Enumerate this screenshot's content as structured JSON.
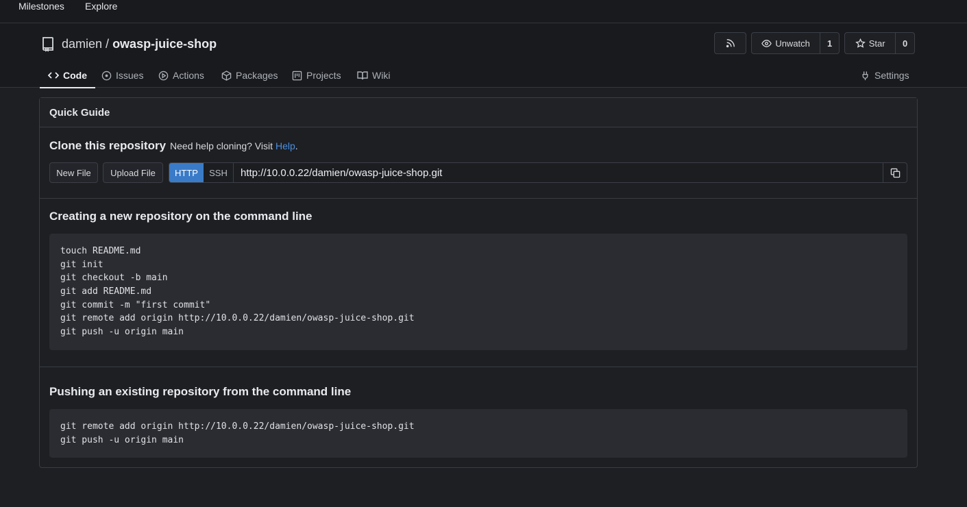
{
  "topnav": {
    "items": [
      "Milestones",
      "Explore"
    ]
  },
  "repo": {
    "owner": "damien",
    "separator": "/",
    "name": "owasp-juice-shop"
  },
  "actions": {
    "unwatch_label": "Unwatch",
    "watch_count": "1",
    "star_label": "Star",
    "star_count": "0"
  },
  "tabs": [
    {
      "label": "Code",
      "icon": "code-icon"
    },
    {
      "label": "Issues",
      "icon": "issue-icon"
    },
    {
      "label": "Actions",
      "icon": "play-icon"
    },
    {
      "label": "Packages",
      "icon": "package-icon"
    },
    {
      "label": "Projects",
      "icon": "project-icon"
    },
    {
      "label": "Wiki",
      "icon": "book-icon"
    }
  ],
  "settings_label": "Settings",
  "quick_guide": {
    "title": "Quick Guide",
    "clone_title": "Clone this repository",
    "clone_help_text": "Need help cloning? Visit",
    "help_link": "Help",
    "help_suffix": ".",
    "new_file_label": "New File",
    "upload_file_label": "Upload File",
    "http_label": "HTTP",
    "ssh_label": "SSH",
    "clone_url": "http://10.0.0.22/damien/owasp-juice-shop.git"
  },
  "new_repo": {
    "title": "Creating a new repository on the command line",
    "lines": [
      "touch README.md",
      "git init",
      "git checkout -b main",
      "git add README.md",
      "git commit -m \"first commit\"",
      "git remote add origin http://10.0.0.22/damien/owasp-juice-shop.git",
      "git push -u origin main"
    ]
  },
  "push_existing": {
    "title": "Pushing an existing repository from the command line",
    "lines": [
      "git remote add origin http://10.0.0.22/damien/owasp-juice-shop.git",
      "git push -u origin main"
    ]
  },
  "colors": {
    "accent": "#3a7bc8",
    "link": "#4a90e2",
    "background": "#1d1f23"
  }
}
